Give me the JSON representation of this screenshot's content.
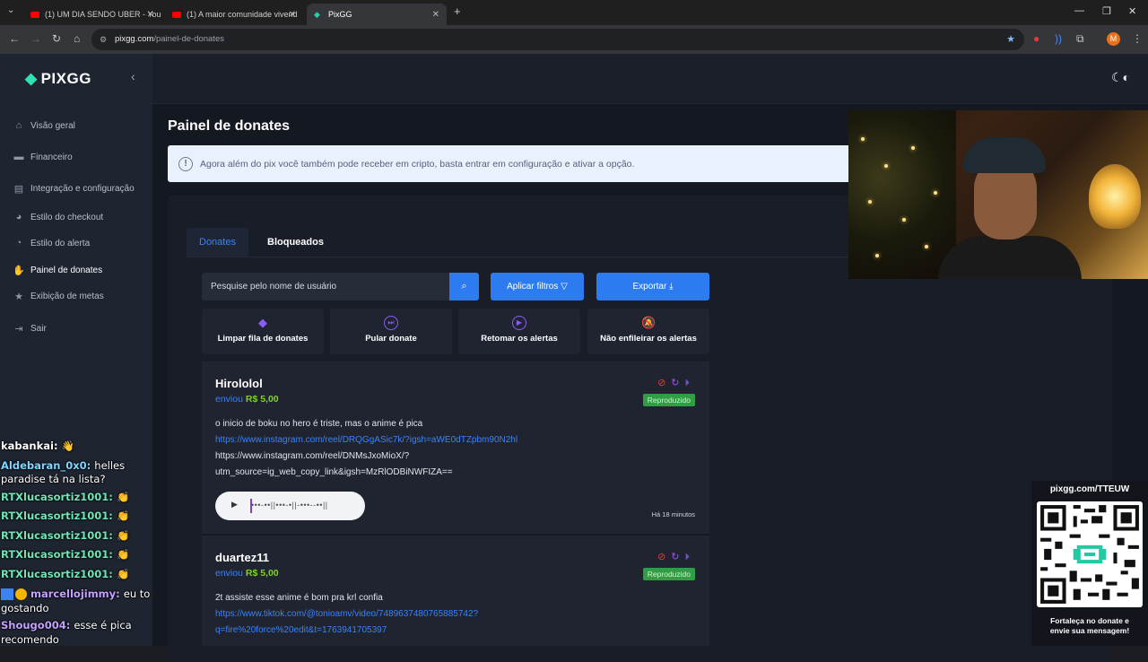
{
  "browser": {
    "tabs": [
      {
        "title": "(1) UM DIA SENDO UBER - You",
        "icon": "youtube-icon"
      },
      {
        "title": "(1) A maior comunidade vivend",
        "icon": "youtube-icon"
      },
      {
        "title": "PixGG",
        "icon": "pixgg-icon"
      }
    ],
    "url_host": "pixgg.com",
    "url_path": "/painel-de-donates",
    "profile_initial": "M"
  },
  "sidebar": {
    "logo": "PIXGG",
    "items": [
      {
        "label": "Visão geral",
        "icon": "home-icon"
      },
      {
        "label": "Financeiro",
        "icon": "wallet-icon"
      },
      {
        "label": "Integração e configuração",
        "icon": "settings-icon"
      },
      {
        "label": "Estilo do checkout",
        "icon": "palette-icon"
      },
      {
        "label": "Estilo do alerta",
        "icon": "palette-icon"
      },
      {
        "label": "Painel de donates",
        "icon": "hand-coin-icon"
      },
      {
        "label": "Exibição de metas",
        "icon": "star-icon"
      },
      {
        "label": "Sair",
        "icon": "logout-icon"
      }
    ]
  },
  "page": {
    "title": "Painel de donates",
    "info": "Agora além do pix você também pode receber em cripto, basta entrar em configuração e ativar a opção.",
    "tabs": [
      "Donates",
      "Bloqueados"
    ],
    "search_placeholder": "Pesquise pelo nome de usuário",
    "filter_label": "Aplicar filtros",
    "export_label": "Exportar",
    "actions": [
      {
        "label": "Limpar fila de donates",
        "icon": "eraser-icon"
      },
      {
        "label": "Pular donate",
        "icon": "skip-icon"
      },
      {
        "label": "Retomar os alertas",
        "icon": "play-circle-icon"
      },
      {
        "label": "Não enfileirar os alertas",
        "icon": "bell-off-icon"
      }
    ]
  },
  "donations": [
    {
      "name": "Hirololol",
      "sent": "enviou",
      "amount": "R$ 5,00",
      "status": "Reproduzido",
      "message": "o inicio de boku no hero é triste, mas o anime é pica",
      "link1": "https://www.instagram.com/reel/DRQGgASic7k/?igsh=aWE0dTZpbm90N2hl",
      "line2": "https://www.instagram.com/reel/DNMsJxoMioX/?",
      "line3": "utm_source=ig_web_copy_link&igsh=MzRlODBiNWFIZA==",
      "waveform": "•••-••||•••-•||-•••--••||",
      "time": "Há 18 minutos"
    },
    {
      "name": "duartez11",
      "sent": "enviou",
      "amount": "R$ 5,00",
      "status": "Reproduzido",
      "message": "2t assiste esse anime é bom pra krl confia",
      "link1": "https://www.tiktok.com/@tonioamv/video/7489637480765885742?",
      "line2": "q=fire%20force%20edit&t=1763941705397"
    }
  ],
  "chat": [
    {
      "user": "kabankai:",
      "text": "👋",
      "color": "#ffffff"
    },
    {
      "user": "Aldebaran_0x0:",
      "text": "helles",
      "color": "#7fd6ff"
    },
    {
      "user": "",
      "text": "paradise tá na lista?",
      "color": "#ffffff"
    },
    {
      "user": "RTXlucasortiz1001:",
      "text": "👏",
      "color": "#6ee7b7"
    },
    {
      "user": "RTXlucasortiz1001:",
      "text": "👏",
      "color": "#6ee7b7"
    },
    {
      "user": "RTXlucasortiz1001:",
      "text": "👏",
      "color": "#6ee7b7"
    },
    {
      "user": "RTXlucasortiz1001:",
      "text": "👏",
      "color": "#6ee7b7"
    },
    {
      "user": "RTXlucasortiz1001:",
      "text": "👏",
      "color": "#6ee7b7"
    },
    {
      "user": "marcellojimmy:",
      "text": "eu to",
      "color": "#c4a1ff"
    },
    {
      "user": "",
      "text": "gostando",
      "color": "#ffffff"
    },
    {
      "user": "Shougo004:",
      "text": "esse é pica",
      "color": "#c4a1ff"
    },
    {
      "user": "",
      "text": "recomendo",
      "color": "#ffffff"
    }
  ],
  "overlay": {
    "qr_title": "pixgg.com/TTEUW",
    "qr_caption_1": "Fortaleça no donate e",
    "qr_caption_2": "envie sua mensagem!"
  }
}
